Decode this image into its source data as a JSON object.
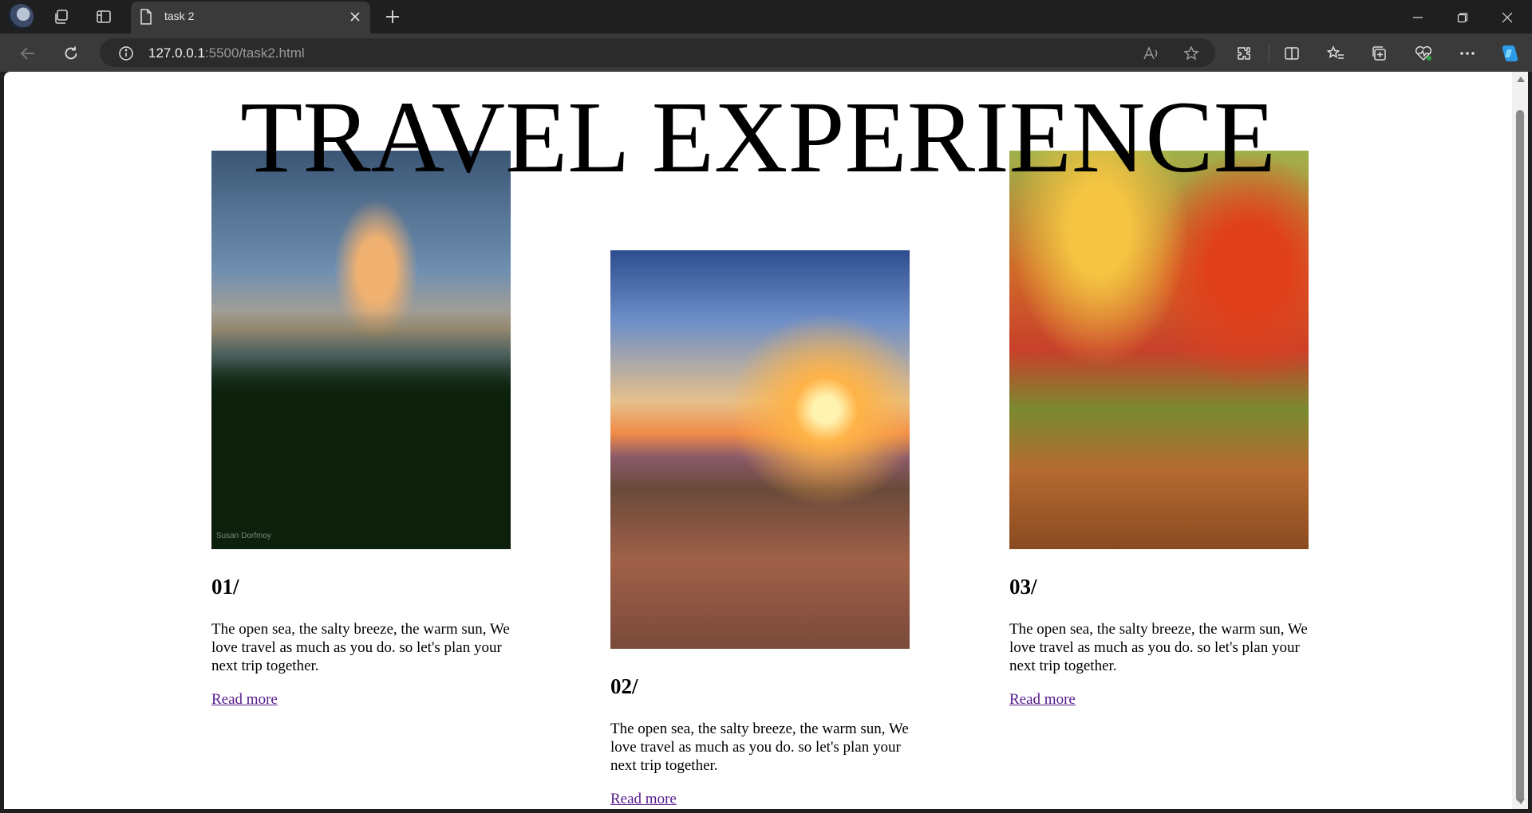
{
  "browser": {
    "tab_title": "task 2",
    "url_host": "127.0.0.1",
    "url_rest": ":5500/task2.html"
  },
  "page": {
    "title": "TRAVEL EXPERIENCE",
    "cards": [
      {
        "number": "01/",
        "text": "The open sea, the salty breeze, the warm sun, We love travel as much as you do. so let's plan your next trip together.",
        "link": "Read more",
        "image_watermark": "Susan Dorfmoy"
      },
      {
        "number": "02/",
        "text": "The open sea, the salty breeze, the warm sun, We love travel as much as you do. so let's plan your next trip together.",
        "link": "Read more"
      },
      {
        "number": "03/",
        "text": "The open sea, the salty breeze, the warm sun, We love travel as much as you do. so let's plan your next trip together.",
        "link": "Read more"
      }
    ]
  },
  "colors": {
    "link_visited": "#551a8b",
    "chrome_dark": "#1f1f1f",
    "toolbar": "#3a3a3a"
  }
}
